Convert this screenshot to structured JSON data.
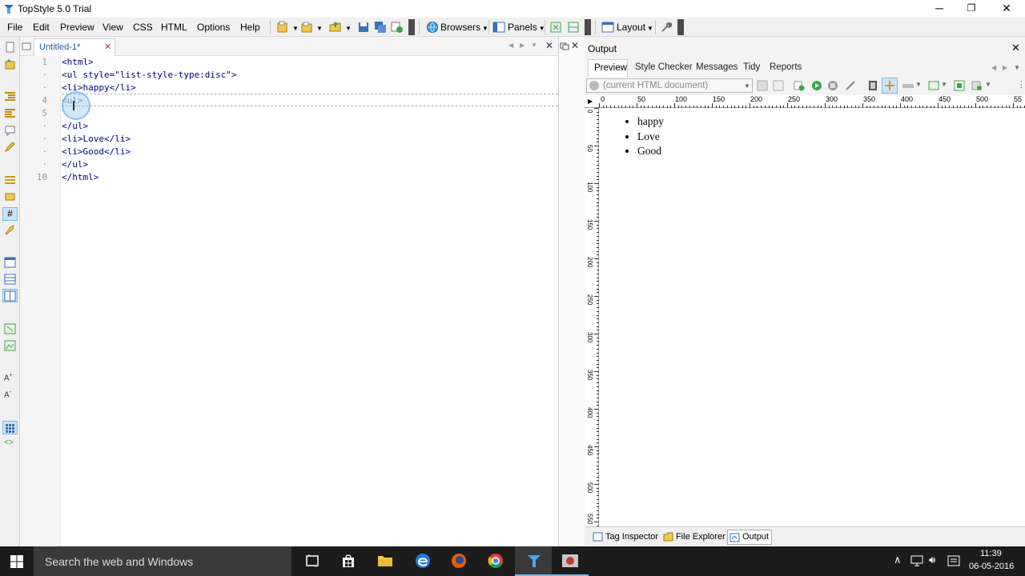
{
  "window": {
    "title": "TopStyle 5.0 Trial",
    "controls": {
      "minimize": "─",
      "restore": "❐",
      "close": "✕"
    }
  },
  "menu": {
    "file": "File",
    "edit": "Edit",
    "view": "View",
    "css": "CSS",
    "html": "HTML",
    "options": "Options",
    "help": "Help"
  },
  "toolbar": {
    "browsers": "Browsers",
    "panels": "Panels",
    "layout": "Layout"
  },
  "editor": {
    "tab_label": "Untitled-1*",
    "lines": [
      {
        "num": "1",
        "text": "<html>"
      },
      {
        "num": "·",
        "text": "<ul style=\"list-style-type:disc\">"
      },
      {
        "num": "·",
        "text": "<li>happy</li>"
      },
      {
        "num": "4",
        "text": "<ul>"
      },
      {
        "num": "5",
        "text": ""
      },
      {
        "num": "·",
        "text": "</ul>"
      },
      {
        "num": "·",
        "text": "<li>Love</li>"
      },
      {
        "num": "·",
        "text": "<li>Good</li>"
      },
      {
        "num": "·",
        "text": "</ul>"
      },
      {
        "num": "10",
        "text": "</html>"
      }
    ]
  },
  "output": {
    "title": "Output",
    "tabs": [
      "Preview",
      "Style Checker",
      "Messages",
      "Tidy",
      "Reports"
    ],
    "document_select": "(current HTML document)",
    "ruler_h": [
      "0",
      "50",
      "100",
      "150",
      "200",
      "250",
      "300",
      "350",
      "400",
      "450",
      "500",
      "55"
    ],
    "ruler_v": [
      "0",
      "50",
      "100",
      "150",
      "200",
      "250",
      "300",
      "350",
      "400",
      "450",
      "500",
      "550"
    ],
    "preview_items": [
      "happy",
      "Love",
      "Good"
    ],
    "bottom_tabs": [
      "Tag Inspector",
      "File Explorer",
      "Output"
    ]
  },
  "taskbar": {
    "search_placeholder": "Search the web and Windows",
    "time": "11:39",
    "date": "06-05-2016"
  },
  "colors": {
    "accent": "#3399ff",
    "taskbar": "#1c1c1c",
    "search_box": "#3a3a3a",
    "tag_text": "#000080"
  }
}
